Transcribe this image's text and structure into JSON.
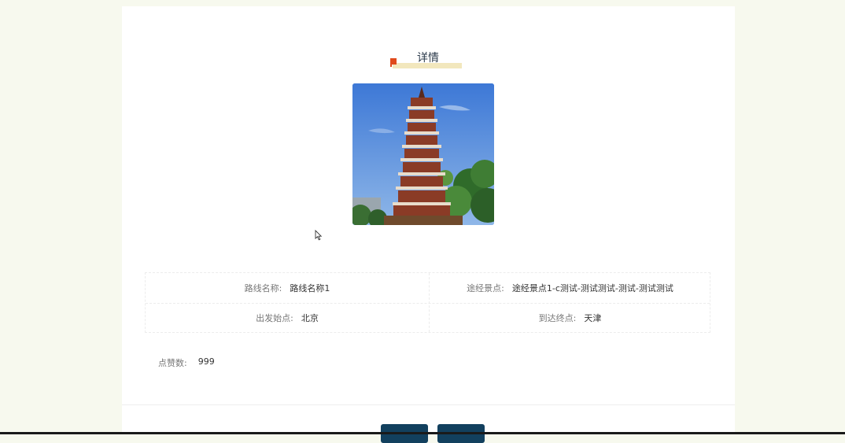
{
  "detail": {
    "title": "详情",
    "fields": {
      "route_name": {
        "label": "路线名称:",
        "value": "路线名称1"
      },
      "via_spots": {
        "label": "途经景点:",
        "value": "途经景点1-c测试-测试测试-测试-测试测试"
      },
      "start": {
        "label": "出发始点:",
        "value": "北京"
      },
      "end": {
        "label": "到达终点:",
        "value": "天津"
      }
    },
    "likes": {
      "label": "点赞数:",
      "value": "999"
    }
  },
  "colors": {
    "background": "#f7f9ee",
    "accent": "#e04a1c",
    "button": "#12405e"
  }
}
